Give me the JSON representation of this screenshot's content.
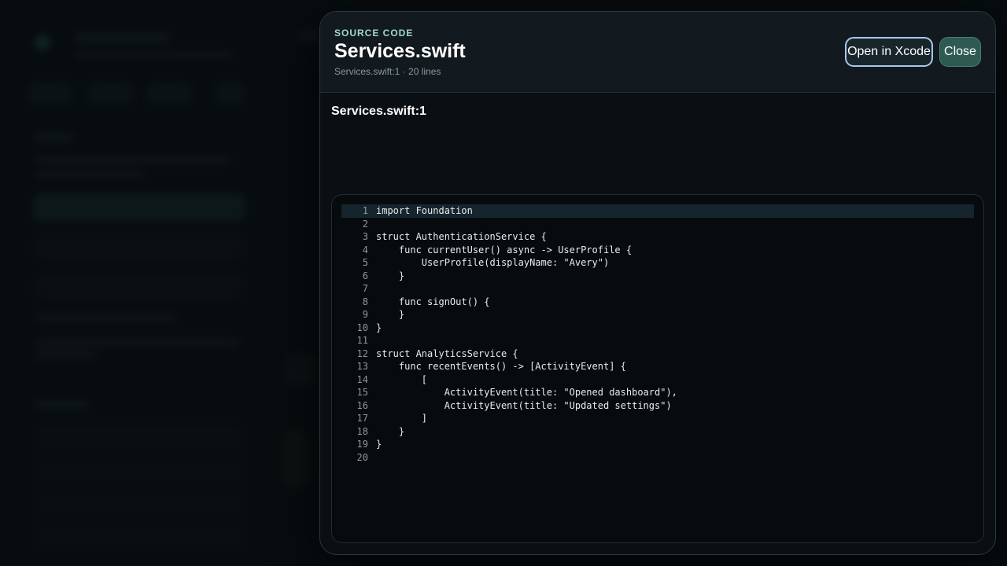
{
  "sheet": {
    "eyebrow": "SOURCE CODE",
    "title": "Services.swift",
    "subtitle": "Services.swift:1 · 20 lines",
    "open_xcode_label": "Open in Xcode",
    "close_label": "Close",
    "location": "Services.swift:1"
  },
  "code": {
    "active_line": 1,
    "lines": [
      {
        "n": "1",
        "text": "import Foundation"
      },
      {
        "n": "2",
        "text": ""
      },
      {
        "n": "3",
        "text": "struct AuthenticationService {"
      },
      {
        "n": "4",
        "text": "    func currentUser() async -> UserProfile {"
      },
      {
        "n": "5",
        "text": "        UserProfile(displayName: \"Avery\")"
      },
      {
        "n": "6",
        "text": "    }"
      },
      {
        "n": "7",
        "text": ""
      },
      {
        "n": "8",
        "text": "    func signOut() {"
      },
      {
        "n": "9",
        "text": "    }"
      },
      {
        "n": "10",
        "text": "}"
      },
      {
        "n": "11",
        "text": ""
      },
      {
        "n": "12",
        "text": "struct AnalyticsService {"
      },
      {
        "n": "13",
        "text": "    func recentEvents() -> [ActivityEvent] {"
      },
      {
        "n": "14",
        "text": "        ["
      },
      {
        "n": "15",
        "text": "            ActivityEvent(title: \"Opened dashboard\"),"
      },
      {
        "n": "16",
        "text": "            ActivityEvent(title: \"Updated settings\")"
      },
      {
        "n": "17",
        "text": "        ]"
      },
      {
        "n": "18",
        "text": "    }"
      },
      {
        "n": "19",
        "text": "}"
      },
      {
        "n": "20",
        "text": ""
      }
    ]
  }
}
